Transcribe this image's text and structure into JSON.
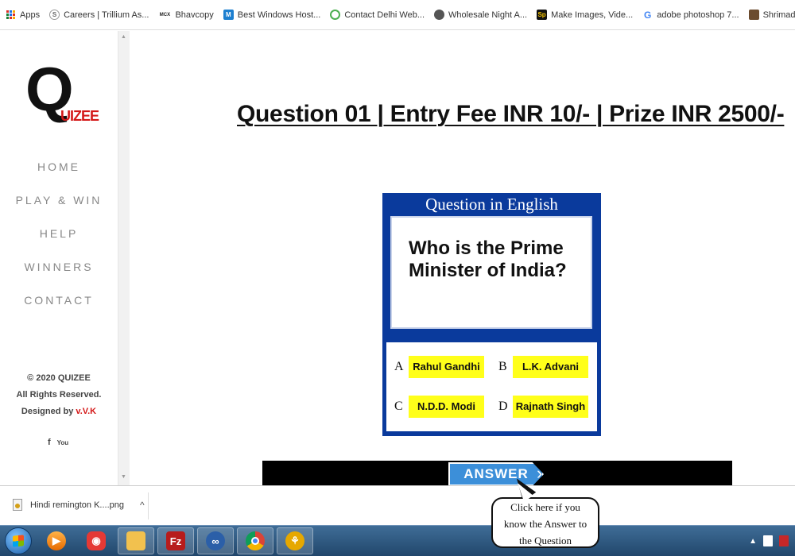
{
  "bookmarks": [
    {
      "icon": "apps-grid-icon",
      "label": "Apps"
    },
    {
      "icon": "trillium-icon",
      "label": "Careers | Trillium As..."
    },
    {
      "icon": "mcx-icon",
      "label": "Bhavcopy"
    },
    {
      "icon": "m-icon",
      "label": "Best Windows Host..."
    },
    {
      "icon": "contact-icon",
      "label": "Contact Delhi Web..."
    },
    {
      "icon": "globe-icon",
      "label": "Wholesale Night A..."
    },
    {
      "icon": "sp-icon",
      "label": "Make Images, Vide..."
    },
    {
      "icon": "google-icon",
      "label": "adobe photoshop 7..."
    },
    {
      "icon": "book-icon",
      "label": "Shrimad Bhagwat G..."
    }
  ],
  "logo": {
    "q": "Q",
    "rest": "UIZEE"
  },
  "nav": [
    "HOME",
    "PLAY & WIN",
    "HELP",
    "WINNERS",
    "CONTACT"
  ],
  "footer": {
    "copyright": "© 2020 QUIZEE",
    "rights": "All Rights Reserved.",
    "designed_by_prefix": "Designed by ",
    "designer": "v.V.K"
  },
  "socials": {
    "facebook": "f",
    "youtube": "You"
  },
  "question_title": "Question 01 | Entry Fee INR 10/- | Prize INR 2500/-",
  "question_card": {
    "header": "Question in English",
    "question": "Who is the Prime Minister of India?",
    "options": [
      {
        "letter": "A",
        "text": "Rahul Gandhi"
      },
      {
        "letter": "B",
        "text": "L.K. Advani"
      },
      {
        "letter": "C",
        "text": "N.D.D. Modi"
      },
      {
        "letter": "D",
        "text": "Rajnath Singh"
      }
    ]
  },
  "answer_button": "ANSWER",
  "bubble": {
    "line1": "Click here if you",
    "line2": "know the Answer to",
    "line3": "the Question"
  },
  "download": {
    "filename": "Hindi remington K....png"
  },
  "colors": {
    "accent_red": "#d41818",
    "card_blue": "#0a3a9c",
    "option_yellow": "#ffff1a",
    "answer_blue": "#3c8fd9"
  }
}
